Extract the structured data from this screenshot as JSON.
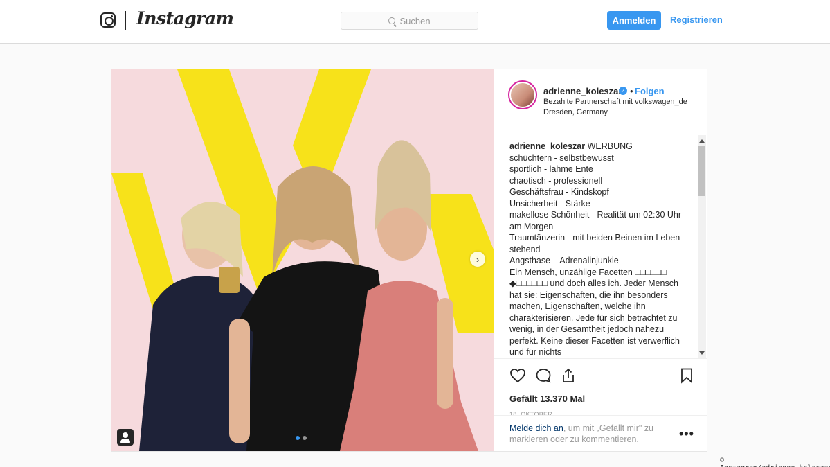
{
  "nav": {
    "brand": "Instagram",
    "search_placeholder": "Suchen",
    "login_label": "Anmelden",
    "register_label": "Registrieren"
  },
  "post": {
    "username": "adrienne_koleszar",
    "verified": true,
    "bullet": "•",
    "follow_label": "Folgen",
    "partnership_prefix": "Bezahlte Partnerschaft mit",
    "partner_name": "volkswagen_de",
    "location": "Dresden, Germany",
    "caption_user": "adrienne_koleszar",
    "caption_lines": [
      "WERBUNG",
      "schüchtern - selbstbewusst",
      "sportlich - lahme Ente",
      "chaotisch - professionell",
      "Geschäftsfrau - Kindskopf",
      "Unsicherheit - Stärke",
      "makellose Schönheit - Realität um 02:30 Uhr am Morgen",
      "Traumtänzerin - mit beiden Beinen im Leben stehend",
      "Angsthase – Adrenalinjunkie",
      "Ein Mensch, unzählige Facetten □□□□□□ ◆□□□□□□ und doch alles ich. Jeder Mensch hat sie: Eigenschaften, die ihn besonders machen, Eigenschaften, welche ihn charakterisieren. Jede für sich betrachtet zu wenig, in der Gesamtheit jedoch nahezu perfekt. Keine dieser Facetten ist verwerflich und für nichts"
    ],
    "likes": "Gefällt 13.370 Mal",
    "date": "18. OKTOBER",
    "login_link": "Melde dich an",
    "login_rest": ", um mit „Gefällt mir\" zu markieren oder zu kommentieren.",
    "more_label": "•••"
  },
  "icons": {
    "logo": "instagram-glyph-icon",
    "search": "search-icon",
    "like": "heart-icon",
    "comment": "comment-icon",
    "share": "share-icon",
    "save": "bookmark-icon",
    "tag": "user-tag-icon",
    "next": "chevron-right-icon"
  },
  "colors": {
    "accent": "#3897f0",
    "image_background": "#f6dadd",
    "brand_yellow": "#f7e21a"
  },
  "credit": "© Instagram/adrienne_koleszar"
}
